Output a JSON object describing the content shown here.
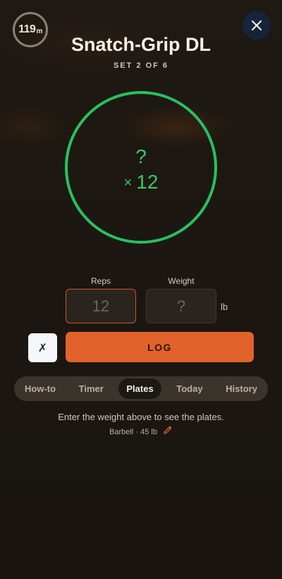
{
  "header": {
    "timer_value": "119",
    "timer_unit": "m",
    "title": "Snatch-Grip DL",
    "subtitle": "SET 2 OF 6"
  },
  "ring": {
    "weight_display": "?",
    "reps_prefix": "×",
    "reps_display": "12",
    "color": "#28c060"
  },
  "fields": {
    "reps_label": "Reps",
    "reps_placeholder": "12",
    "weight_label": "Weight",
    "weight_placeholder": "?",
    "weight_unit": "lb"
  },
  "actions": {
    "cancel_glyph": "✗",
    "log_label": "LOG",
    "accent": "#e2622b"
  },
  "tabs": [
    {
      "label": "How-to",
      "active": false
    },
    {
      "label": "Timer",
      "active": false
    },
    {
      "label": "Plates",
      "active": true
    },
    {
      "label": "Today",
      "active": false
    },
    {
      "label": "History",
      "active": false
    }
  ],
  "plates": {
    "hint": "Enter the weight above to see the plates.",
    "barbell_info": "Barbell · 45 lb"
  },
  "icons": {
    "close": "close-icon",
    "edit": "pencil-icon"
  }
}
